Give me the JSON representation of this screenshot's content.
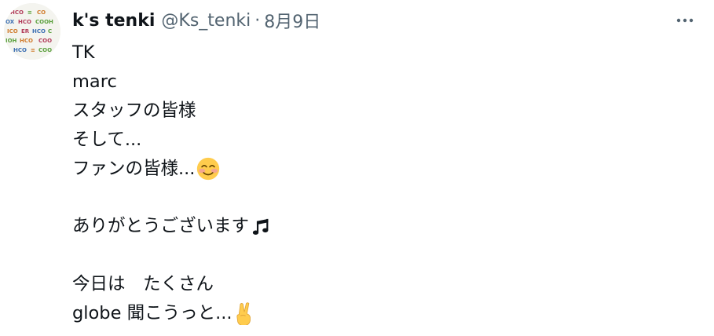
{
  "tweet": {
    "author": {
      "display_name": "k's tenki",
      "handle": "@Ks_tenki"
    },
    "separator": "·",
    "timestamp": "8月9日",
    "lines": [
      "TK",
      "marc",
      "スタッフの皆様",
      "そして...",
      "ファンの皆様...",
      "",
      "ありがとうございます",
      "",
      "今日は　たくさん",
      "globe 聞こうっと..."
    ],
    "emojis": {
      "line5": "smiling-face-with-smiling-eyes-icon",
      "line7": "musical-notes-icon",
      "line10": "victory-hand-icon"
    },
    "colors": {
      "text": "#0f1419",
      "secondary": "#536471",
      "emoji_yellow": "#ffcc4d",
      "blush": "#f29e9e"
    }
  }
}
